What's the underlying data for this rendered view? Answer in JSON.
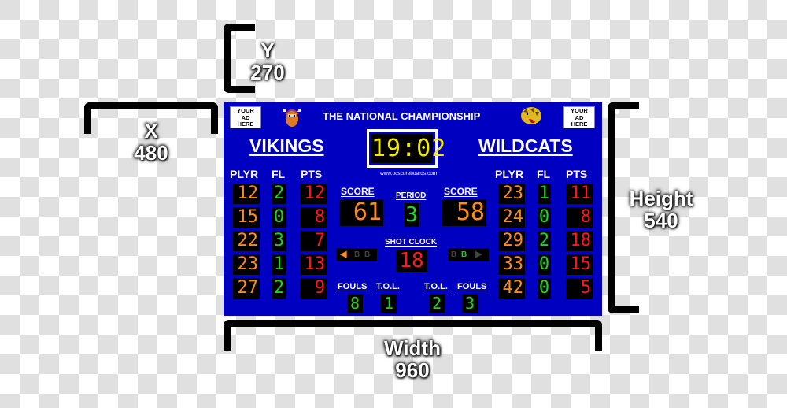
{
  "dimensions": {
    "y": {
      "label": "Y",
      "value": "270"
    },
    "x": {
      "label": "X",
      "value": "480"
    },
    "height": {
      "label": "Height",
      "value": "540"
    },
    "width": {
      "label": "Width",
      "value": "960"
    }
  },
  "scoreboard": {
    "title": "THE NATIONAL CHAMPIONSHIP",
    "ad_left": [
      "YOUR",
      "AD",
      "HERE"
    ],
    "ad_right": [
      "YOUR",
      "AD",
      "HERE"
    ],
    "game_clock": "19:02",
    "website": "www.pcscoreboards.com",
    "period_label": "PERIOD",
    "period": "3",
    "shot_clock_label": "SHOT CLOCK",
    "shot_clock": "18",
    "score_label": "SCORE",
    "fouls_label": "FOULS",
    "tol_label": "T.O.L.",
    "column_headers": {
      "player": "PLYR",
      "fouls": "FL",
      "points": "PTS"
    },
    "colors": {
      "board": "#0000c0",
      "player": "#ff8c1a",
      "fouls": "#1fd41f",
      "points": "#ff1a1a",
      "clock": "#f2e800"
    },
    "home": {
      "name": "VIKINGS",
      "logo": "viking-logo",
      "score": "61",
      "fouls": "8",
      "tol": "1",
      "possession_arrow": true,
      "bonus": [
        "B",
        "B"
      ],
      "bonus_lit": [
        false,
        false
      ],
      "players": [
        {
          "number": "12",
          "fouls": "2",
          "points": "12"
        },
        {
          "number": "15",
          "fouls": "0",
          "points": "8"
        },
        {
          "number": "22",
          "fouls": "3",
          "points": "7"
        },
        {
          "number": "23",
          "fouls": "1",
          "points": "13"
        },
        {
          "number": "27",
          "fouls": "2",
          "points": "9"
        }
      ]
    },
    "away": {
      "name": "WILDCATS",
      "logo": "wildcat-logo",
      "score": "58",
      "fouls": "3",
      "tol": "2",
      "possession_arrow": false,
      "bonus": [
        "B",
        "B"
      ],
      "bonus_lit": [
        false,
        true
      ],
      "players": [
        {
          "number": "23",
          "fouls": "1",
          "points": "11"
        },
        {
          "number": "24",
          "fouls": "0",
          "points": "8"
        },
        {
          "number": "29",
          "fouls": "2",
          "points": "18"
        },
        {
          "number": "33",
          "fouls": "0",
          "points": "15"
        },
        {
          "number": "42",
          "fouls": "0",
          "points": "5"
        }
      ]
    }
  }
}
